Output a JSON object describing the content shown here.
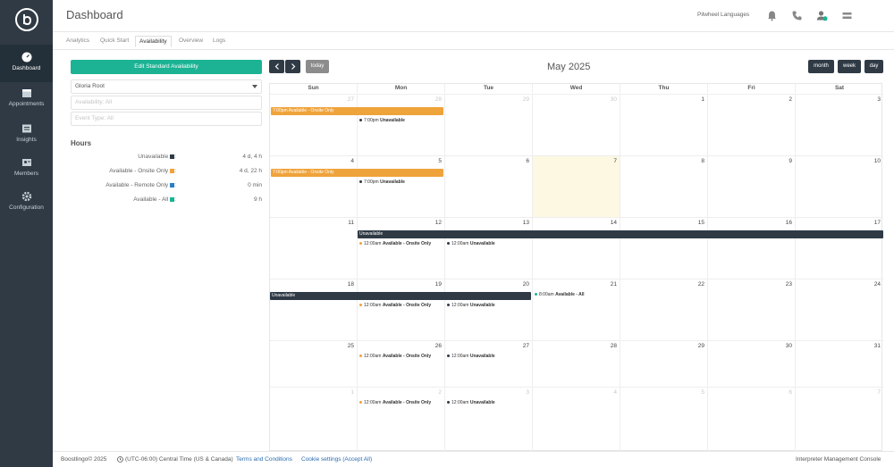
{
  "sidebar": {
    "items": [
      {
        "label": "Dashboard",
        "icon": "dashboard-icon"
      },
      {
        "label": "Appointments",
        "icon": "calendar-icon"
      },
      {
        "label": "Insights",
        "icon": "insights-icon"
      },
      {
        "label": "Members",
        "icon": "members-icon"
      },
      {
        "label": "Configuration",
        "icon": "gear-icon"
      }
    ]
  },
  "header": {
    "title": "Dashboard",
    "language": "Pilwheel Languages"
  },
  "tabs": [
    "Analytics",
    "Quick Start",
    "Availability",
    "Overview",
    "Logs"
  ],
  "left": {
    "edit_button": "Edit Standard Availability",
    "interpreter": "Gloria Root",
    "availability_placeholder": "Availability: All",
    "event_type_placeholder": "Event Type: All",
    "hours_title": "Hours",
    "hours": [
      {
        "label": "Unavailable",
        "value": "4 d, 4 h",
        "color": "#2f3a45"
      },
      {
        "label": "Available - Onsite Only",
        "value": "4 d, 22 h",
        "color": "#efa33b"
      },
      {
        "label": "Available - Remote Only",
        "value": "0 min",
        "color": "#2a7fc4"
      },
      {
        "label": "Available - All",
        "value": "9 h",
        "color": "#1bb394"
      }
    ]
  },
  "calendar": {
    "title": "May 2025",
    "today_label": "today",
    "views": [
      "month",
      "week",
      "day"
    ],
    "dow": [
      "Sun",
      "Mon",
      "Tue",
      "Wed",
      "Thu",
      "Fri",
      "Sat"
    ],
    "weeks": [
      [
        "27",
        "28",
        "29",
        "30",
        "1",
        "2",
        "3"
      ],
      [
        "4",
        "5",
        "6",
        "7",
        "8",
        "9",
        "10"
      ],
      [
        "11",
        "12",
        "13",
        "14",
        "15",
        "16",
        "17"
      ],
      [
        "18",
        "19",
        "20",
        "21",
        "22",
        "23",
        "24"
      ],
      [
        "25",
        "26",
        "27",
        "28",
        "29",
        "30",
        "31"
      ],
      [
        "1",
        "2",
        "3",
        "4",
        "5",
        "6",
        "7"
      ]
    ],
    "events": {
      "w1_bar": "7:00pm Available - Onsite Only",
      "w1_evt_time": "7:00pm",
      "w1_evt_label": "Unavailable",
      "w2_bar": "7:00pm Available - Onsite Only",
      "w2_evt_time": "7:00pm",
      "w2_evt_label": "Unavailable",
      "w3_bar": "Unavailable",
      "w4_bar": "Unavailable",
      "onsite_time": "12:00am",
      "onsite_label": "Available - Onsite Only",
      "unavail_time": "12:00am",
      "unavail_label": "Unavailable",
      "w4_all_time": "8:00am",
      "w4_all_label": "Available - All"
    },
    "colors": {
      "dark": "#2f3a45",
      "orange": "#efa33b",
      "green": "#1bb394",
      "today": "#fdf8e2"
    }
  },
  "footer": {
    "copyright": "Boostlingo© 2025",
    "timezone": "(UTC-06:00) Central Time (US & Canada)",
    "terms": "Terms and Conditions",
    "cookies": "Cookie settings (Accept All)",
    "console": "Interpreter Management Console"
  }
}
